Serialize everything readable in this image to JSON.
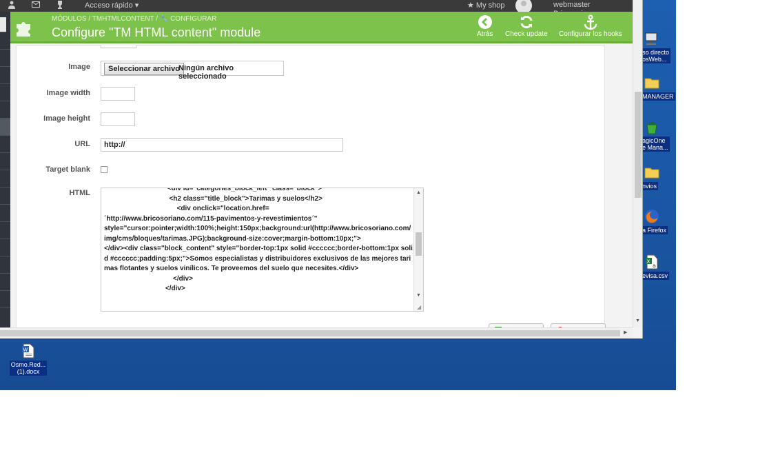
{
  "topbar": {
    "quick_access": "Acceso rápido ▾",
    "my_shop": "★ My shop",
    "user": "webmaster Bricosoriano ▾"
  },
  "header": {
    "breadcrumb": "MÓDULOS  /  TMHTMLCONTENT  /  🔧 CONFIGURAR",
    "title": "Configure \"TM HTML content\" module",
    "tools": [
      {
        "label": "Atrás",
        "icon": "arrow-left-circle-icon"
      },
      {
        "label": "Check update",
        "icon": "refresh-icon"
      },
      {
        "label": "Configurar los hooks",
        "icon": "anchor-icon"
      }
    ]
  },
  "form": {
    "image": {
      "label": "Image",
      "button": "Seleccionar archivo",
      "status": "Ningún archivo seleccionado"
    },
    "image_width": {
      "label": "Image width",
      "value": ""
    },
    "image_height": {
      "label": "Image height",
      "value": ""
    },
    "url": {
      "label": "URL",
      "value": "http://"
    },
    "target_blank": {
      "label": "Target blank",
      "checked": false
    },
    "html": {
      "label": "HTML",
      "value": "                                 <div id=\"categories_block_left\" class=\"block\">\n                                  <h2 class=\"title_block\">Tarimas y suelos</h2>\n                                      <div onclick=\"location.href=\n´http://www.bricosoriano.com/115-pavimentos-y-revestimientos´\"\nstyle=\"cursor:pointer;width:100%;height:150px;background:url(http://www.bricosoriano.com/img/cms/bloques/tarimas.JPG);background-size:cover;margin-bottom:10px;\">\n</div><div class=\"block_content\" style=\"border-top:1px solid #cccccc;border-bottom:1px solid #cccccc;padding:5px;\">Somos especialistas y distribuidores exclusivos de las mejores tarimas flotantes y suelos vinílicos. Te proveemos del suelo que necesites.</div>\n                                    </div>\n                                </div>"
    }
  },
  "desktop_icons": {
    "right": [
      {
        "label": "so directo\nosWeb...",
        "icon": "network-shortcut-icon"
      },
      {
        "label": "MANAGER",
        "icon": "folder-icon"
      },
      {
        "label": "agicOne\ne Mana...",
        "icon": "magicone-app-icon"
      },
      {
        "label": "nvios",
        "icon": "folder-icon"
      },
      {
        "label": "a Firefox",
        "icon": "firefox-icon"
      },
      {
        "label": "evisa.csv",
        "icon": "excel-file-icon"
      }
    ],
    "bottom": [
      {
        "label": "Osmo.Red...\n(1).docx",
        "icon": "word-file-icon"
      }
    ]
  },
  "colors": {
    "header_green": "#7dc24a",
    "desktop_blue": "#1a56a3",
    "topbar_dark": "#3a3a3a"
  }
}
